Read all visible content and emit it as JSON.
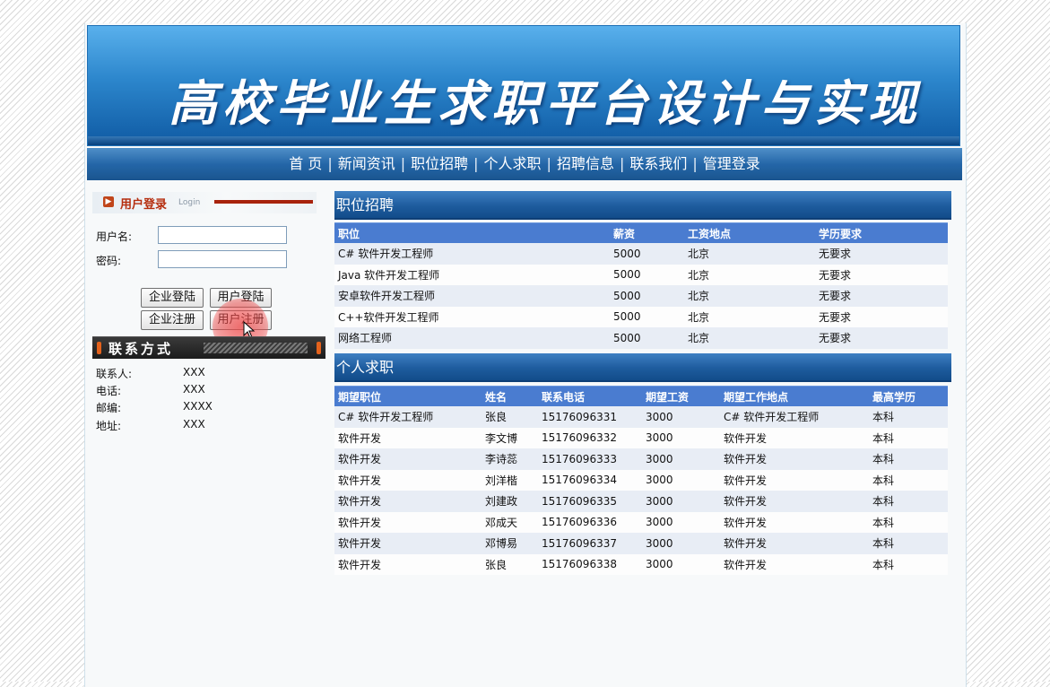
{
  "banner": {
    "title": "高校毕业生求职平台设计与实现"
  },
  "nav": {
    "items": [
      "首 页",
      "新闻资讯",
      "职位招聘",
      "个人求职",
      "招聘信息",
      "联系我们",
      "管理登录"
    ],
    "separator": "|"
  },
  "login": {
    "title": "用户登录",
    "subtitle": "Login",
    "username_label": "用户名:",
    "password_label": "密码:",
    "username_value": "",
    "password_value": "",
    "buttons": {
      "company_login": "企业登陆",
      "user_login": "用户登陆",
      "company_register": "企业注册",
      "user_register": "用户注册"
    }
  },
  "contact": {
    "title": "联系方式",
    "rows": [
      {
        "label": "联系人:",
        "value": "XXX"
      },
      {
        "label": "电话:",
        "value": "XXX"
      },
      {
        "label": "邮编:",
        "value": "XXXX"
      },
      {
        "label": "地址:",
        "value": "XXX"
      }
    ]
  },
  "jobs": {
    "title": "职位招聘",
    "headers": [
      "职位",
      "薪资",
      "工资地点",
      "学历要求"
    ],
    "rows": [
      [
        "C# 软件开发工程师",
        "5000",
        "北京",
        "无要求"
      ],
      [
        "Java 软件开发工程师",
        "5000",
        "北京",
        "无要求"
      ],
      [
        "安卓软件开发工程师",
        "5000",
        "北京",
        "无要求"
      ],
      [
        "C++软件开发工程师",
        "5000",
        "北京",
        "无要求"
      ],
      [
        "网络工程师",
        "5000",
        "北京",
        "无要求"
      ]
    ]
  },
  "seekers": {
    "title": "个人求职",
    "headers": [
      "期望职位",
      "姓名",
      "联系电话",
      "期望工资",
      "期望工作地点",
      "最高学历"
    ],
    "rows": [
      [
        "C# 软件开发工程师",
        "张良",
        "15176096331",
        "3000",
        "C# 软件开发工程师",
        "本科"
      ],
      [
        "软件开发",
        "李文博",
        "15176096332",
        "3000",
        "软件开发",
        "本科"
      ],
      [
        "软件开发",
        "李诗蕊",
        "15176096333",
        "3000",
        "软件开发",
        "本科"
      ],
      [
        "软件开发",
        "刘洋楷",
        "15176096334",
        "3000",
        "软件开发",
        "本科"
      ],
      [
        "软件开发",
        "刘建政",
        "15176096335",
        "3000",
        "软件开发",
        "本科"
      ],
      [
        "软件开发",
        "邓成天",
        "15176096336",
        "3000",
        "软件开发",
        "本科"
      ],
      [
        "软件开发",
        "邓博易",
        "15176096337",
        "3000",
        "软件开发",
        "本科"
      ],
      [
        "软件开发",
        "张良",
        "15176096338",
        "3000",
        "软件开发",
        "本科"
      ]
    ]
  },
  "colors": {
    "nav_bg": "#2466a8",
    "header_row": "#4a7cd0",
    "login_accent": "#b52d0e",
    "cursor_highlight": "#f04646"
  }
}
